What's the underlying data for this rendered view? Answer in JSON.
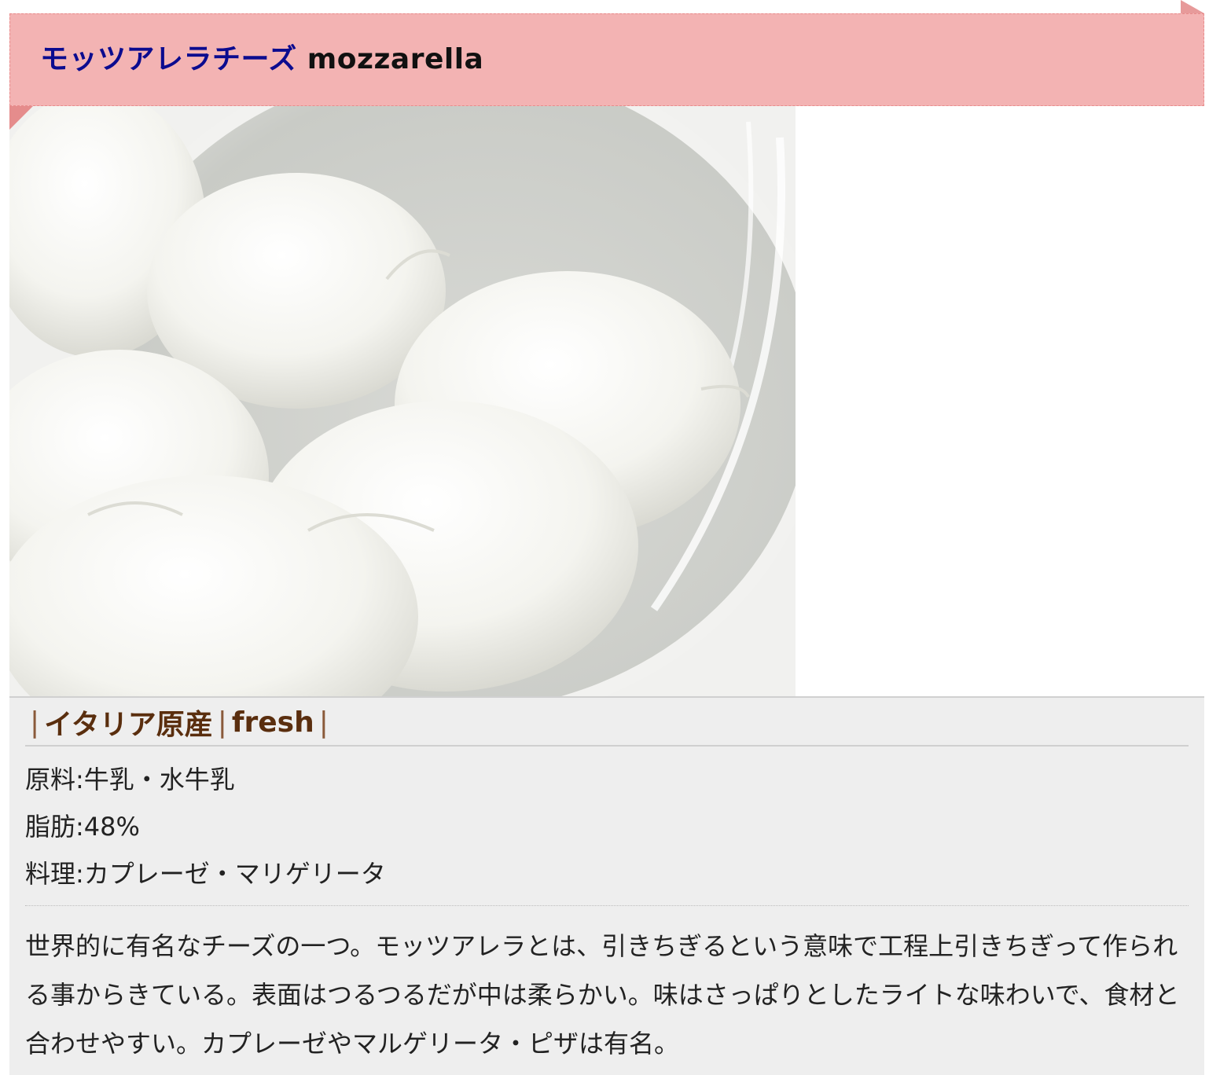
{
  "heading": {
    "title_ja": "モッツアレラチーズ",
    "title_en": "mozzarella"
  },
  "photo": {
    "alt": "mozzarella-cheese-photo"
  },
  "tags": {
    "sep": "|",
    "origin": "イタリア原産",
    "type": "fresh"
  },
  "specs": [
    {
      "label": "原料",
      "value": "牛乳・水牛乳"
    },
    {
      "label": "脂肪",
      "value": "48%"
    },
    {
      "label": "料理",
      "value": "カプレーゼ・マリゲリータ"
    }
  ],
  "spec_colon": ":",
  "description": "世界的に有名なチーズの一つ。モッツアレラとは、引きちぎるという意味で工程上引きちぎって作られる事からきている。表面はつるつるだが中は柔らかい。味はさっぱりとしたライトな味わいで、食材と合わせやすい。カプレーゼやマルゲリータ・ピザは有名。",
  "colors": {
    "ribbon": "#f3b3b3",
    "ribbon_border": "#e88c8c",
    "title_ja": "#0b0b8f",
    "tag_text": "#5a2e0e",
    "info_bg": "#eeeeee"
  }
}
